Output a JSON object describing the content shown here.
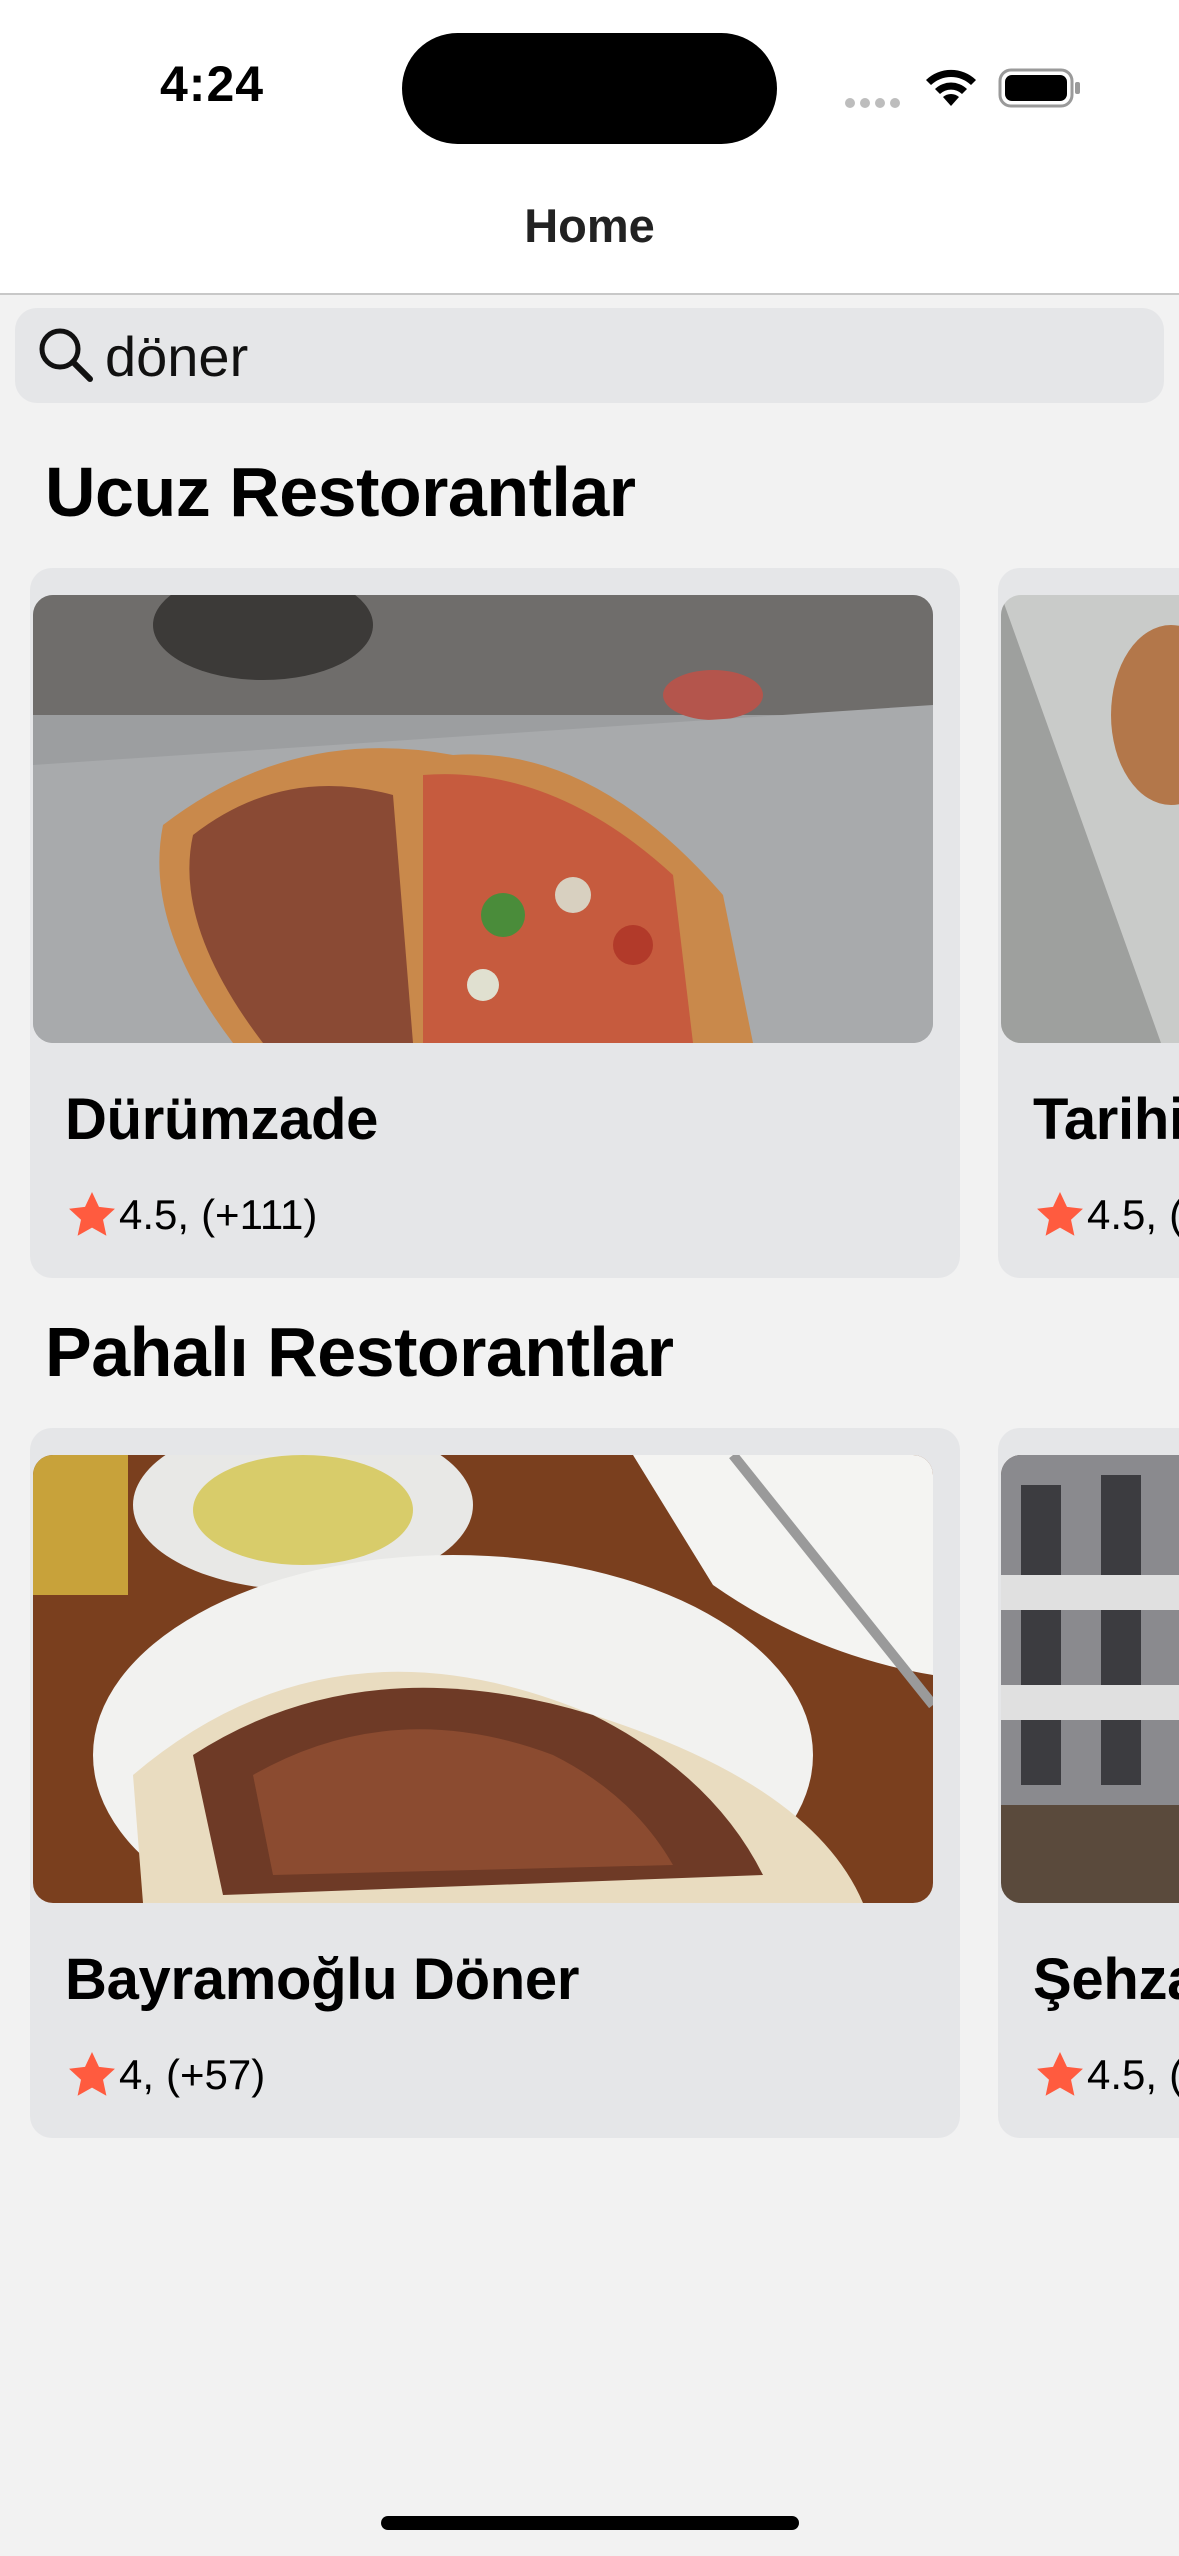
{
  "status_bar": {
    "time": "4:24"
  },
  "nav": {
    "title": "Home"
  },
  "search": {
    "query": "döner"
  },
  "colors": {
    "star": "#ff5b3f",
    "card_bg": "#e5e6e8",
    "page_bg": "#f2f2f2"
  },
  "sections": [
    {
      "title": "Ucuz Restorantlar",
      "cards": [
        {
          "name": "Dürümzade",
          "rating": "4.5,",
          "reviews": "(+111)"
        },
        {
          "name": "Tarihi",
          "rating": "4.5,",
          "reviews": "("
        }
      ]
    },
    {
      "title": "Pahalı Restorantlar",
      "cards": [
        {
          "name": "Bayramoğlu Döner",
          "rating": "4,",
          "reviews": "(+57)"
        },
        {
          "name": "Şehza",
          "rating": "4.5,",
          "reviews": "("
        }
      ]
    }
  ]
}
